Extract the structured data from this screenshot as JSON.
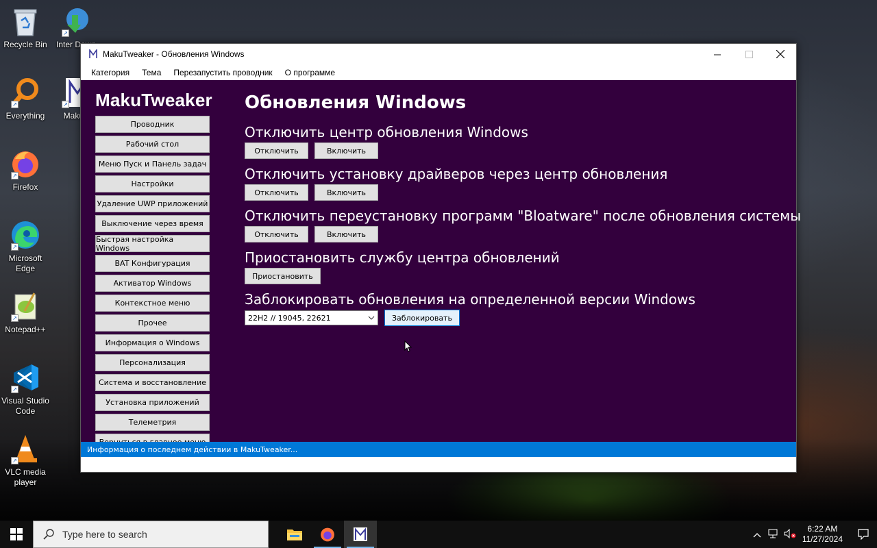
{
  "desktop": {
    "icons": [
      {
        "name": "recycle-bin",
        "label": "Recycle Bin"
      },
      {
        "name": "internet-download-manager",
        "label": "Inter Down"
      },
      {
        "name": "everything",
        "label": "Everything"
      },
      {
        "name": "makutweaker",
        "label": "MakuT"
      },
      {
        "name": "firefox",
        "label": "Firefox"
      },
      {
        "name": "microsoft-edge",
        "label": "Microsoft Edge"
      },
      {
        "name": "notepad-plus-plus",
        "label": "Notepad++"
      },
      {
        "name": "vscode",
        "label": "Visual Studio Code"
      },
      {
        "name": "vlc",
        "label": "VLC media player"
      }
    ]
  },
  "window": {
    "title": "MakuTweaker - Обновления Windows",
    "menu": [
      "Категория",
      "Тема",
      "Перезапустить проводник",
      "О программе"
    ],
    "brand": "MakuTweaker",
    "nav": [
      "Проводник",
      "Рабочий стол",
      "Меню Пуск и Панель задач",
      "Настройки",
      "Удаление UWP приложений",
      "Выключение через время",
      "Быстрая настройка Windows",
      "BAT Конфигурация",
      "Активатор Windows",
      "Контекстное меню",
      "Прочее",
      "Информация о Windows",
      "Персонализация",
      "Система и восстановление",
      "Установка приложений",
      "Телеметрия",
      "Вернуться в главное меню"
    ],
    "page_title": "Обновления Windows",
    "sections": [
      {
        "title": "Отключить центр обновления Windows",
        "buttons": [
          "Отключить",
          "Включить"
        ]
      },
      {
        "title": "Отключить установку драйверов через центр обновления",
        "buttons": [
          "Отключить",
          "Включить"
        ]
      },
      {
        "title": "Отключить переустановку программ \"Bloatware\" после обновления системы",
        "buttons": [
          "Отключить",
          "Включить"
        ]
      },
      {
        "title": "Приостановить службу центра обновлений",
        "buttons": [
          "Приостановить"
        ]
      },
      {
        "title": "Заблокировать обновления на определенной версии Windows",
        "select_value": "22H2 // 19045, 22621",
        "buttons": [
          "Заблокировать"
        ]
      }
    ],
    "status": "Информация о последнем действии в MakuTweaker..."
  },
  "taskbar": {
    "search_placeholder": "Type here to search",
    "time": "6:22 AM",
    "date": "11/27/2024"
  },
  "colors": {
    "content_bg": "#33003d",
    "status_bg": "#0078d7",
    "accent": "#0078d7"
  }
}
